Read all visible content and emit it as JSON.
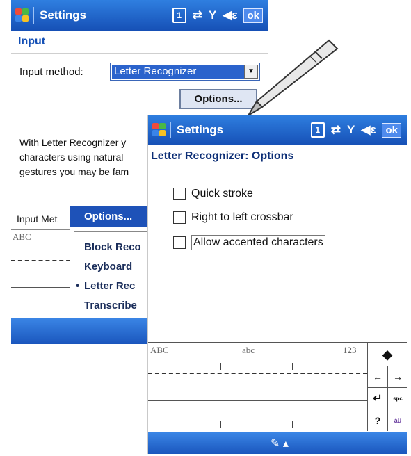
{
  "back_screen": {
    "title": "Settings",
    "ok_label": "ok",
    "section_title": "Input",
    "input_method_label": "Input method:",
    "input_method_value": "Letter Recognizer",
    "options_button": "Options...",
    "description_lines": [
      "With Letter Recognizer y",
      "characters using natural",
      "gestures you may be fam"
    ],
    "input_method_label_truncated": "Input Met",
    "input_panel_label": "ABC",
    "popup": {
      "title": "Options...",
      "items": [
        "Block Reco",
        "Keyboard",
        "Letter Rec",
        "Transcribe"
      ],
      "selected_index": 2
    }
  },
  "front_screen": {
    "title": "Settings",
    "ok_label": "ok",
    "section_title": "Letter Recognizer: Options",
    "checkboxes": [
      {
        "label": "Quick stroke",
        "checked": false
      },
      {
        "label": "Right to left crossbar",
        "checked": false
      },
      {
        "label": "Allow accented characters",
        "checked": false,
        "focused": true
      }
    ],
    "recognizer": {
      "labels": [
        "ABC",
        "abc",
        "123"
      ],
      "keys": [
        "←",
        "→",
        "?"
      ]
    }
  },
  "colors": {
    "titlebar": "#1650b6",
    "accent_blue": "#134fb5",
    "selection": "#2b63cc"
  },
  "icons": [
    "windows-logo",
    "input-icon",
    "connectivity-icon",
    "signal-icon",
    "speaker-icon",
    "stylus"
  ]
}
